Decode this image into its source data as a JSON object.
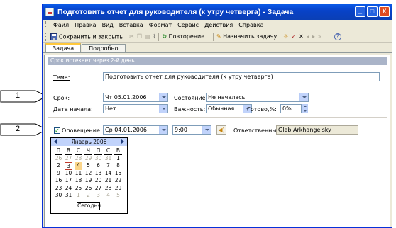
{
  "callouts": [
    "1",
    "2"
  ],
  "window": {
    "title": "Подготовить отчет для руководителя (к утру четверга) - Задача",
    "buttons": [
      "_",
      "□",
      "X"
    ]
  },
  "menu": [
    "Файл",
    "Правка",
    "Вид",
    "Вставка",
    "Формат",
    "Сервис",
    "Действия",
    "Справка"
  ],
  "toolbar": {
    "save_close": "Сохранить и закрыть",
    "recurrence": "Повторение...",
    "assign": "Назначить задачу"
  },
  "tabs": [
    "Задача",
    "Подробно"
  ],
  "info": "Срок истекает через 2-й день.",
  "subject": {
    "label": "Тема:",
    "value": "Подготовить отчет для руководителя (к утру четверга)"
  },
  "due": {
    "label": "Срок:",
    "value": "Чт 05.01.2006"
  },
  "start": {
    "label": "Дата начала:",
    "value": "Нет"
  },
  "status": {
    "label": "Состояние:",
    "value": "Не началась"
  },
  "priority": {
    "label": "Важность:",
    "value": "Обычная"
  },
  "complete": {
    "label": "Готово,%:",
    "value": "0%"
  },
  "reminder": {
    "label": "Оповещение:",
    "date": "Ср 04.01.2006",
    "time": "9:00"
  },
  "owner": {
    "label": "Ответственный:",
    "value": "Gleb Arkhangelsky"
  },
  "calendar": {
    "month": "Январь 2006",
    "weekdays": [
      "П",
      "В",
      "С",
      "Ч",
      "П",
      "С",
      "В"
    ],
    "days": [
      [
        "26",
        "27",
        "28",
        "29",
        "30",
        "31",
        "1"
      ],
      [
        "2",
        "3",
        "4",
        "5",
        "6",
        "7",
        "8"
      ],
      [
        "9",
        "10",
        "11",
        "12",
        "13",
        "14",
        "15"
      ],
      [
        "16",
        "17",
        "18",
        "19",
        "20",
        "21",
        "22"
      ],
      [
        "23",
        "24",
        "25",
        "26",
        "27",
        "28",
        "29"
      ],
      [
        "30",
        "31",
        "1",
        "2",
        "3",
        "4",
        "5"
      ]
    ],
    "today_label": "Сегодня"
  }
}
